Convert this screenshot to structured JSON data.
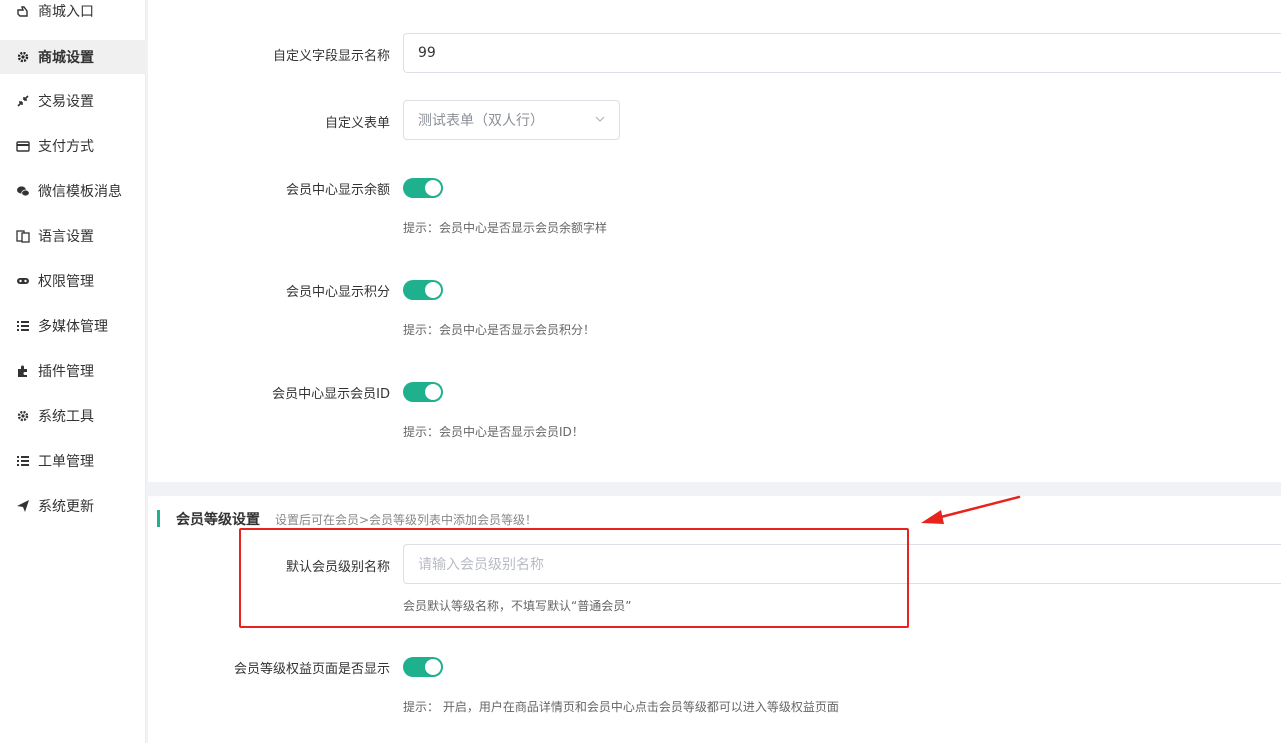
{
  "sidebar": {
    "items": [
      {
        "label": "商城入口",
        "icon": "hand-point-icon"
      },
      {
        "label": "商城设置",
        "icon": "gear-icon",
        "active": true
      },
      {
        "label": "交易设置",
        "icon": "compress-arrows-icon"
      },
      {
        "label": "支付方式",
        "icon": "credit-card-icon"
      },
      {
        "label": "微信模板消息",
        "icon": "wechat-icon"
      },
      {
        "label": "语言设置",
        "icon": "language-icon"
      },
      {
        "label": "权限管理",
        "icon": "mask-icon"
      },
      {
        "label": "多媒体管理",
        "icon": "list-icon"
      },
      {
        "label": "插件管理",
        "icon": "puzzle-icon"
      },
      {
        "label": "系统工具",
        "icon": "gear-icon"
      },
      {
        "label": "工单管理",
        "icon": "list-icon"
      },
      {
        "label": "系统更新",
        "icon": "paper-plane-icon"
      }
    ]
  },
  "form": {
    "custom_field_label": "自定义字段显示名称",
    "custom_field_value": "99",
    "custom_form_label": "自定义表单",
    "custom_form_selected": "测试表单（双人行）",
    "show_balance_label": "会员中心显示余额",
    "show_balance_hint": "提示：会员中心是否显示会员余额字样",
    "show_points_label": "会员中心显示积分",
    "show_points_hint": "提示：会员中心是否显示会员积分！",
    "show_id_label": "会员中心显示会员ID",
    "show_id_hint": "提示：会员中心是否显示会员ID！"
  },
  "level_section": {
    "title": "会员等级设置",
    "desc": "设置后可在会员>会员等级列表中添加会员等级！",
    "default_level_label": "默认会员级别名称",
    "default_level_placeholder": "请输入会员级别名称",
    "default_level_hint": "会员默认等级名称，不填写默认“普通会员”",
    "level_page_label": "会员等级权益页面是否显示",
    "level_page_hint": "提示： 开启，用户在商品详情页和会员中心点击会员等级都可以进入等级权益页面"
  },
  "colors": {
    "accent": "#1fb08e",
    "annotation": "#e8231d"
  }
}
